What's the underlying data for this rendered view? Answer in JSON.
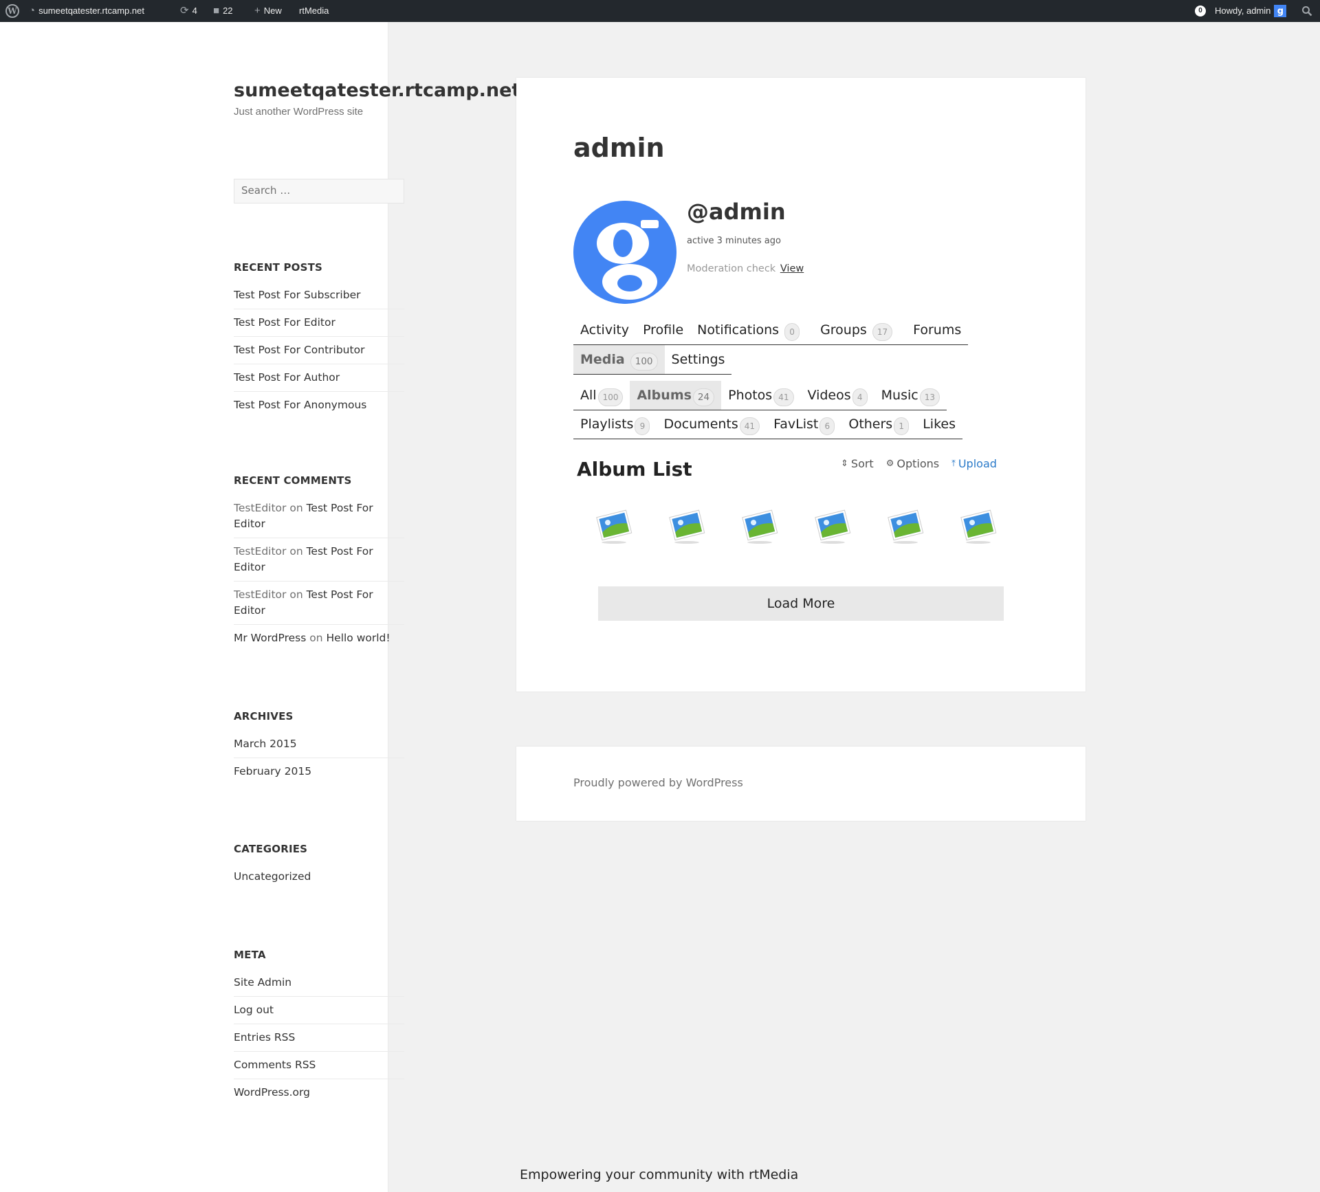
{
  "adminbar": {
    "site_name": "sumeetqatester.rtcamp.net",
    "updates_count": "4",
    "comments_count": "22",
    "new_label": "New",
    "rtmedia_label": "rtMedia",
    "notification_count": "0",
    "howdy": "Howdy, admin"
  },
  "sidebar": {
    "site_title": "sumeetqatester.rtcamp.net",
    "site_description": "Just another WordPress site",
    "search_placeholder": "Search …",
    "recent_posts": {
      "heading": "RECENT POSTS",
      "items": [
        "Test Post For Subscriber",
        "Test Post For Editor",
        "Test Post For Contributor",
        "Test Post For Author",
        "Test Post For Anonymous"
      ]
    },
    "recent_comments": {
      "heading": "RECENT COMMENTS",
      "items": [
        {
          "author": "TestEditor",
          "on": "on",
          "post": "Test Post For Editor"
        },
        {
          "author": "TestEditor",
          "on": "on",
          "post": "Test Post For Editor"
        },
        {
          "author": "TestEditor",
          "on": "on",
          "post": "Test Post For Editor"
        },
        {
          "author": "Mr WordPress",
          "on": "on",
          "post": "Hello world!"
        }
      ]
    },
    "archives": {
      "heading": "ARCHIVES",
      "items": [
        "March 2015",
        "February 2015"
      ]
    },
    "categories": {
      "heading": "CATEGORIES",
      "items": [
        "Uncategorized"
      ]
    },
    "meta": {
      "heading": "META",
      "items": [
        "Site Admin",
        "Log out",
        "Entries RSS",
        "Comments RSS",
        "WordPress.org"
      ]
    }
  },
  "main": {
    "page_title": "admin",
    "handle": "@admin",
    "active": "active 3 minutes ago",
    "moderation_label": "Moderation check",
    "moderation_link": "View",
    "nav_row1": [
      {
        "label": "Activity",
        "count": ""
      },
      {
        "label": "Profile",
        "count": ""
      },
      {
        "label": "Notifications",
        "count": "0"
      },
      {
        "label": "Groups",
        "count": "17"
      },
      {
        "label": "Forums",
        "count": ""
      }
    ],
    "nav_row2": [
      {
        "label": "Media",
        "count": "100",
        "current": true
      },
      {
        "label": "Settings",
        "count": ""
      }
    ],
    "media_row1": [
      {
        "label": "All",
        "count": "100"
      },
      {
        "label": "Albums",
        "count": "24",
        "current": true
      },
      {
        "label": "Photos",
        "count": "41"
      },
      {
        "label": "Videos",
        "count": "4"
      },
      {
        "label": "Music",
        "count": "13"
      }
    ],
    "media_row2": [
      {
        "label": "Playlists",
        "count": "9"
      },
      {
        "label": "Documents",
        "count": "41"
      },
      {
        "label": "FavList",
        "count": "6"
      },
      {
        "label": "Others",
        "count": "1"
      },
      {
        "label": "Likes",
        "count": ""
      }
    ],
    "album_list_title": "Album List",
    "actions": {
      "sort": "Sort",
      "options": "Options",
      "upload": "Upload"
    },
    "album_thumb_count": 6,
    "load_more": "Load More"
  },
  "footer": {
    "powered": "Proudly powered by WordPress"
  },
  "tagline": "Empowering your community with rtMedia",
  "colors": {
    "adminbar": "#23282d",
    "accent_link": "#2a7ac9",
    "avatar_blue": "#4285f4"
  }
}
